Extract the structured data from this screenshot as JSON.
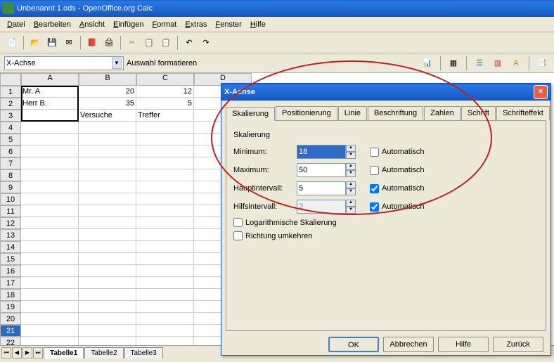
{
  "window": {
    "title": "Unbenannt 1.ods - OpenOffice.org Calc"
  },
  "menu": [
    "Datei",
    "Bearbeiten",
    "Ansicht",
    "Einfügen",
    "Format",
    "Extras",
    "Fenster",
    "Hilfe"
  ],
  "namebox": {
    "value": "X-Achse",
    "label": "Auswahl formatieren"
  },
  "columns": [
    "A",
    "B",
    "C",
    "D"
  ],
  "rows": [
    "1",
    "2",
    "3",
    "4",
    "5",
    "6",
    "7",
    "8",
    "9",
    "10",
    "11",
    "12",
    "13",
    "14",
    "15",
    "16",
    "17",
    "18",
    "19",
    "20",
    "21",
    "22"
  ],
  "selected_row": 21,
  "cells": {
    "A1": "Mr. A",
    "B1": "20",
    "C1": "12",
    "A2": "Herr B.",
    "B2": "35",
    "C2": "5",
    "B3": "Versuche",
    "C3": "Treffer"
  },
  "sheets": [
    "Tabelle1",
    "Tabelle2",
    "Tabelle3"
  ],
  "active_sheet": 0,
  "dialog": {
    "title": "X-Achse",
    "tabs": [
      "Skalierung",
      "Positionierung",
      "Linie",
      "Beschriftung",
      "Zahlen",
      "Schrift",
      "Schrifteffekt"
    ],
    "active_tab": 0,
    "group": "Skalierung",
    "fields": {
      "min": {
        "label": "Minimum:",
        "value": "18",
        "auto": "Automatisch",
        "checked": false
      },
      "max": {
        "label": "Maximum:",
        "value": "50",
        "auto": "Automatisch",
        "checked": false
      },
      "major": {
        "label": "Hauptintervall:",
        "value": "5",
        "auto": "Automatisch",
        "checked": true
      },
      "minor": {
        "label": "Hilfsintervall:",
        "value": "2",
        "auto": "Automatisch",
        "checked": true
      }
    },
    "log": "Logarithmische Skalierung",
    "reverse": "Richtung umkehren",
    "buttons": {
      "ok": "OK",
      "cancel": "Abbrechen",
      "help": "Hilfe",
      "back": "Zurück"
    }
  }
}
